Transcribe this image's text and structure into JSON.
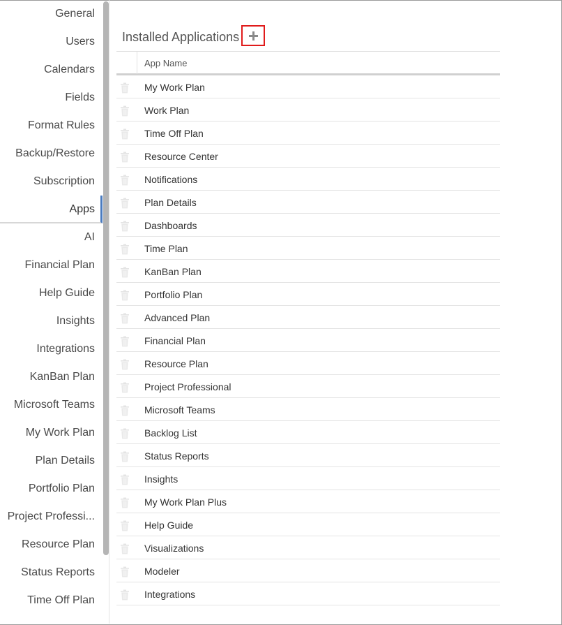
{
  "sidebar": {
    "items": [
      {
        "label": "General"
      },
      {
        "label": "Users"
      },
      {
        "label": "Calendars"
      },
      {
        "label": "Fields"
      },
      {
        "label": "Format Rules"
      },
      {
        "label": "Backup/Restore"
      },
      {
        "label": "Subscription"
      },
      {
        "label": "Apps",
        "active": true
      },
      {
        "label": "AI"
      },
      {
        "label": "Financial Plan"
      },
      {
        "label": "Help Guide"
      },
      {
        "label": "Insights"
      },
      {
        "label": "Integrations"
      },
      {
        "label": "KanBan Plan"
      },
      {
        "label": "Microsoft Teams"
      },
      {
        "label": "My Work Plan"
      },
      {
        "label": "Plan Details"
      },
      {
        "label": "Portfolio Plan"
      },
      {
        "label": "Project Professi..."
      },
      {
        "label": "Resource Plan"
      },
      {
        "label": "Status Reports"
      },
      {
        "label": "Time Off Plan"
      }
    ]
  },
  "main": {
    "title": "Installed Applications",
    "add_icon": "plus-icon",
    "table": {
      "header": {
        "app_name": "App Name"
      },
      "rows": [
        "My Work Plan",
        "Work Plan",
        "Time Off Plan",
        "Resource Center",
        "Notifications",
        "Plan Details",
        "Dashboards",
        "Time Plan",
        "KanBan Plan",
        "Portfolio Plan",
        "Advanced Plan",
        "Financial Plan",
        "Resource Plan",
        "Project Professional",
        "Microsoft Teams",
        "Backlog List",
        "Status Reports",
        "Insights",
        "My Work Plan Plus",
        "Help Guide",
        "Visualizations",
        "Modeler",
        "Integrations"
      ],
      "row_icon": "trash-icon"
    }
  },
  "colors": {
    "accent": "#4a7bbf",
    "highlight_border": "#e01b1b",
    "scrollbar": "#b5b5b5"
  }
}
